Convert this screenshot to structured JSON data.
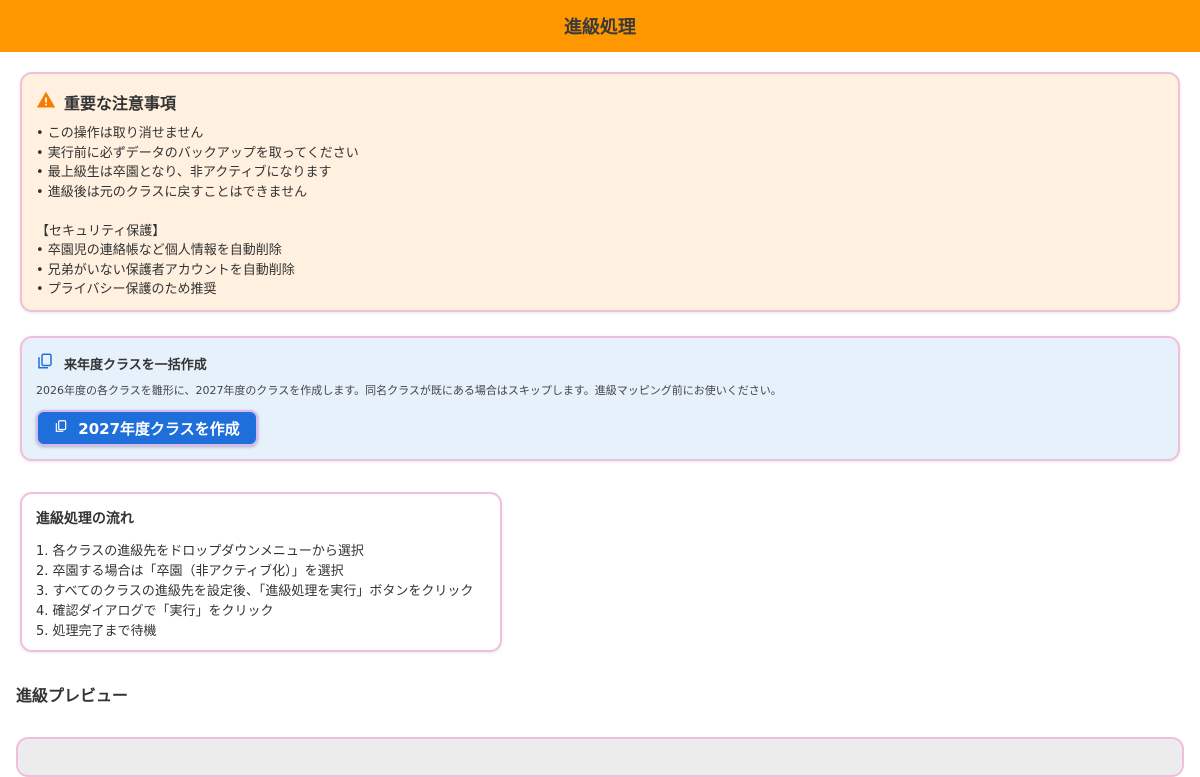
{
  "header": {
    "title": "進級処理"
  },
  "warning": {
    "title": "重要な注意事項",
    "items": [
      "• この操作は取り消せません",
      "• 実行前に必ずデータのバックアップを取ってください",
      "• 最上級生は卒園となり、非アクティブになります",
      "• 進級後は元のクラスに戻すことはできません"
    ],
    "security_heading": "【セキュリティ保護】",
    "security_items": [
      "• 卒園児の連絡帳など個人情報を自動削除",
      "• 兄弟がいない保護者アカウントを自動削除",
      "• プライバシー保護のため推奨"
    ],
    "icon": "warning-triangle-icon",
    "icon_color": "#f57c00"
  },
  "bulk_create": {
    "title": "来年度クラスを一括作成",
    "description": "2026年度の各クラスを雛形に、2027年度のクラスを作成します。同名クラスが既にある場合はスキップします。進級マッピング前にお使いください。",
    "button_label": "2027年度クラスを作成",
    "icon": "copy-icon",
    "button_color": "#1e6fd9"
  },
  "flow": {
    "title": "進級処理の流れ",
    "steps": [
      "1. 各クラスの進級先をドロップダウンメニューから選択",
      "2. 卒園する場合は「卒園（非アクティブ化）」を選択",
      "3. すべてのクラスの進級先を設定後、「進級処理を実行」ボタンをクリック",
      "4. 確認ダイアログで「実行」をクリック",
      "5. 処理完了まで待機"
    ]
  },
  "preview": {
    "title": "進級プレビュー"
  },
  "colors": {
    "header": "#ff9800",
    "warning_bg": "#fff0df",
    "info_bg": "#e6f1fc",
    "card_border": "#f0bfdc"
  }
}
